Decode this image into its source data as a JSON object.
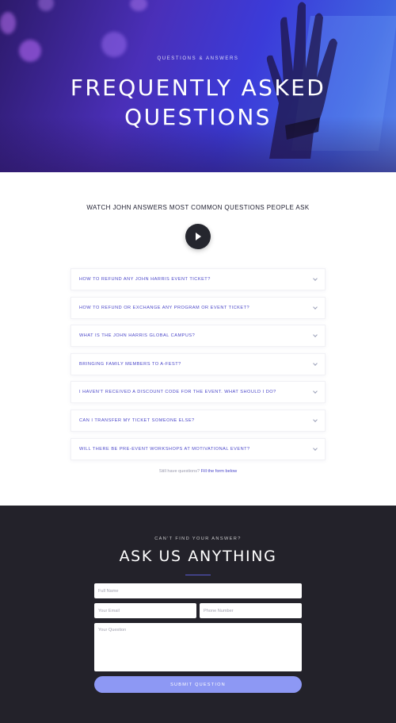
{
  "hero": {
    "eyebrow": "QUESTIONS & ANSWERS",
    "title_line1": "FREQUENTLY ASKED",
    "title_line2": "QUESTIONS"
  },
  "video": {
    "title": "WATCH JOHN ANSWERS MOST COMMON QUESTIONS PEOPLE ASK",
    "play_icon": "play-icon"
  },
  "faq": {
    "items": [
      {
        "question": "HOW TO REFUND ANY JOHN HARRIS EVENT TICKET?"
      },
      {
        "question": "HOW TO REFUND OR EXCHANGE ANY PROGRAM OR EVENT TICKET?"
      },
      {
        "question": "WHAT IS THE JOHN HARRIS GLOBAL CAMPUS?"
      },
      {
        "question": "BRINGING FAMILY MEMBERS TO A-FEST?"
      },
      {
        "question": "I HAVEN'T RECEIVED A DISCOUNT CODE FOR THE EVENT. WHAT SHOULD I DO?"
      },
      {
        "question": "CAN I TRANSFER MY TICKET SOMEONE ELSE?"
      },
      {
        "question": "WILL THERE BE PRE-EVENT WORKSHOPS AT MOTIVATIONAL EVENT?"
      }
    ],
    "still_text": "Still have questions?",
    "still_link": "Fill the form below"
  },
  "contact": {
    "eyebrow": "CAN'T FIND YOUR ANSWER?",
    "heading": "ASK US ANYTHING",
    "name_placeholder": "Full Name",
    "email_placeholder": "Your Email",
    "phone_placeholder": "Phone Number",
    "question_placeholder": "Your Question",
    "submit_label": "SUBMIT QUESTION"
  },
  "colors": {
    "accent": "#4b47c9",
    "button": "#8d98f4",
    "dark_bg": "#23222a"
  }
}
